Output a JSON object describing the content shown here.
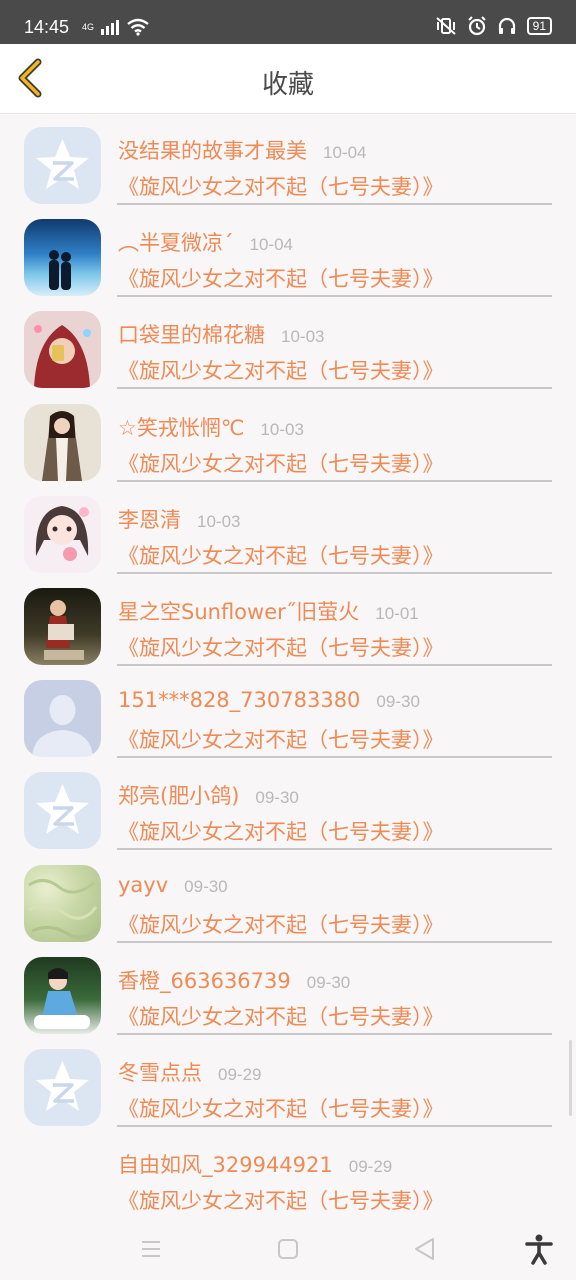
{
  "status_bar": {
    "time": "14:45",
    "network": "4G",
    "battery": "91"
  },
  "header": {
    "title": "收藏"
  },
  "favorites": [
    {
      "name": "没结果的故事才最美",
      "date": "10-04",
      "story": "《旋风少女之对不起（七号夫妻）》",
      "avatar": "qq-default-icon"
    },
    {
      "name": "︵半夏微凉´",
      "date": "10-04",
      "story": "《旋风少女之对不起（七号夫妻）》",
      "avatar": "photo-couple"
    },
    {
      "name": "口袋里的棉花糖",
      "date": "10-03",
      "story": "《旋风少女之对不起（七号夫妻）》",
      "avatar": "photo-red-hood"
    },
    {
      "name": "☆笑戎怅惘℃",
      "date": "10-03",
      "story": "《旋风少女之对不起（七号夫妻）》",
      "avatar": "photo-girl-jacket"
    },
    {
      "name": "李恩清",
      "date": "10-03",
      "story": "《旋风少女之对不起（七号夫妻）》",
      "avatar": "photo-girl-pink"
    },
    {
      "name": "星之空Sunflower˝旧萤火",
      "date": "10-01",
      "story": "《旋风少女之对不起（七号夫妻）》",
      "avatar": "photo-dark-room"
    },
    {
      "name": "151***828_730783380",
      "date": "09-30",
      "story": "《旋风少女之对不起（七号夫妻）》",
      "avatar": "default-person-icon"
    },
    {
      "name": "郑亮(肥小鸽)",
      "date": "09-30",
      "story": "《旋风少女之对不起（七号夫妻）》",
      "avatar": "qq-default-icon"
    },
    {
      "name": "yayv",
      "date": "09-30",
      "story": "《旋风少女之对不起（七号夫妻）》",
      "avatar": "photo-green-texture"
    },
    {
      "name": "香橙_663636739",
      "date": "09-30",
      "story": "《旋风少女之对不起（七号夫妻）》",
      "avatar": "photo-girl-sitting"
    },
    {
      "name": "冬雪点点",
      "date": "09-29",
      "story": "《旋风少女之对不起（七号夫妻）》",
      "avatar": "qq-default-icon"
    },
    {
      "name": "自由如风_329944921",
      "date": "09-29",
      "story": "《旋风少女之对不起（七号夫妻）》",
      "avatar": ""
    }
  ],
  "colors": {
    "accent": "#f08a55",
    "back_arrow": "#f2b51a",
    "date": "#b9b9b9",
    "header_text": "#4a4a4a"
  },
  "nav_bar": {
    "menu": "menu-icon",
    "home": "home-icon",
    "back": "back-triangle-icon",
    "accessibility": "accessibility-icon"
  }
}
